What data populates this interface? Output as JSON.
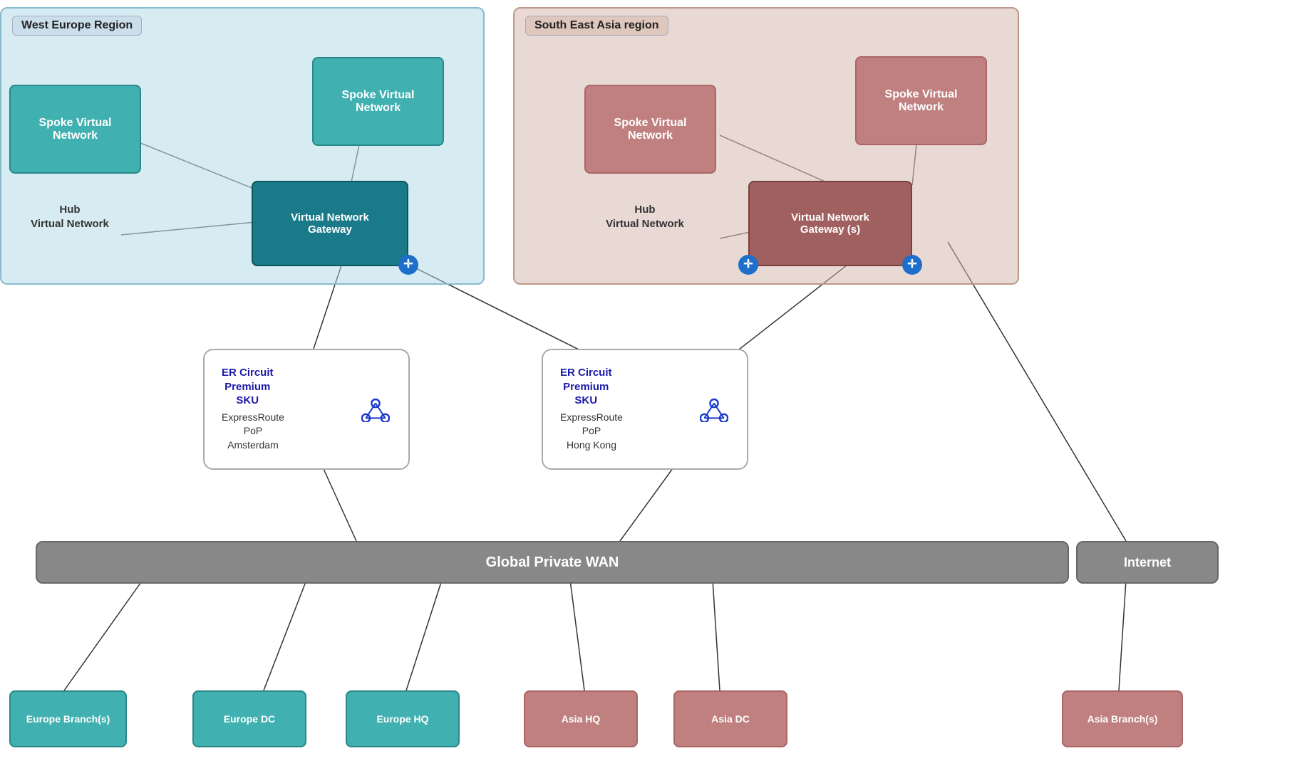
{
  "regions": {
    "west": {
      "label": "West Europe Region"
    },
    "sea": {
      "label": "South East Asia region"
    }
  },
  "boxes": {
    "spoke_west_left": "Spoke Virtual\nNetwork",
    "spoke_west_right": "Spoke Virtual\nNetwork",
    "hub_west": "Hub\nVirtual Network",
    "gateway_west": "Virtual Network\nGateway",
    "spoke_sea_left": "Spoke Virtual\nNetwork",
    "spoke_sea_right": "Spoke Virtual\nNetwork",
    "hub_sea": "Hub\nVirtual Network",
    "gateway_sea": "Virtual Network\nGateway (s)",
    "er_amsterdam_title": "ER Circuit\nPremium\nSKU",
    "er_amsterdam_pop": "ExpressRoute\nPoP\nAmsterdam",
    "er_hk_title": "ER Circuit\nPremium\nSKU",
    "er_hk_pop": "ExpressRoute\nPoP\nHong Kong",
    "global_wan": "Global Private WAN",
    "internet": "Internet",
    "europe_branches": "Europe Branch(s)",
    "europe_dc": "Europe DC",
    "europe_hq": "Europe HQ",
    "asia_hq": "Asia HQ",
    "asia_dc": "Asia DC",
    "asia_branches": "Asia Branch(s)"
  }
}
